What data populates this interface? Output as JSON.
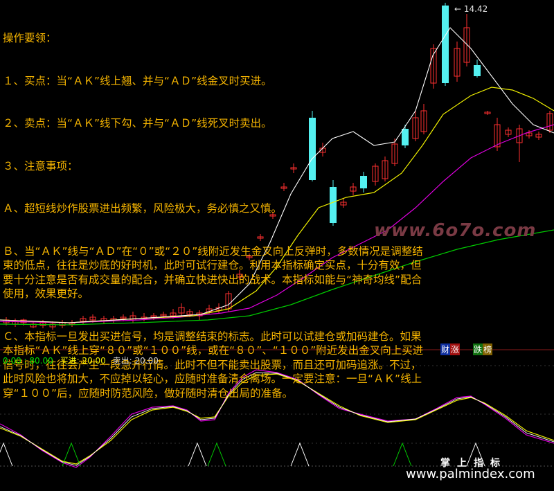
{
  "notes": {
    "title": "操作要领：",
    "lines": [
      "１、买点：当“ＡＫ”线上翘、并与“ＡＤ”线金叉时买进。",
      "２、卖点：当“ＡＫ”线下勾、并与“ＡＤ”线死叉时卖出。",
      "３、注意事项：",
      "Ａ、超短线炒作股票进出频繁，风险极大，务必慎之又慎。",
      "Ｂ、当“ＡＫ”线与“ＡＤ”在“０”或“２０”线附近发生金叉向上反弹时，多数情况是调整结束的低点，往往是炒底的好时机，此时可试行建仓。利用本指标确定买点，十分有效，但要十分注意是否有成交量的配合，并确立快进快出的战术。本指标如能与“神奇均线”配合使用，效果更好。",
      "Ｃ、本指标一旦发出买进信号，均是调整结束的标志。此时可以试建仓或加码建仓。如果本指标“ＡＫ”线上穿“８０”或“１００”线，或在“８０”、“１００”附近发出金叉向上买进信号时，往往会产生一段急升行情。此时不但不能卖出股票，而且还可加码追涨。不过，此时风险也将加大，不应掉以轻心，应随时准备清仓离场。一定要注意：一旦“ＡＫ”线上穿“１００”后，应随时防范风险，做好随时清仓出局的准备。"
    ]
  },
  "price_high_label": "14.42",
  "watermark_top": "www.6o7o.com",
  "indicator_legend": {
    "levels": "0.00 : 80.00",
    "buy": "买进: 20.00",
    "sell": "卖出: 20.00"
  },
  "badges": [
    "财",
    "涨",
    "跌",
    "榜"
  ],
  "brand": "掌上指标",
  "site": "www.palmindex.com",
  "colors": {
    "bg": "#000000",
    "note_text": "#f5b400",
    "up_candle": "#ff3030",
    "down_candle": "#54f0f0",
    "ma_white": "#ffffff",
    "ma_yellow": "#f0f000",
    "ma_magenta": "#e000e0",
    "ma_green": "#00cc00",
    "signal_green": "#00cc00",
    "signal_white": "#ffffff"
  }
}
